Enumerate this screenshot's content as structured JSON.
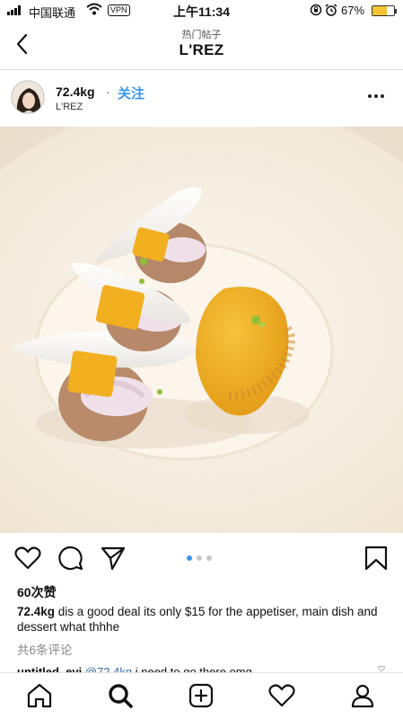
{
  "status_bar": {
    "carrier": "中国联通",
    "vpn": "VPN",
    "time": "上午11:34",
    "battery_percent": "67%",
    "battery_level": 0.67,
    "icons": [
      "signal-icon",
      "wifi-icon",
      "rotation-lock-icon",
      "alarm-icon",
      "battery-icon"
    ]
  },
  "header": {
    "subtitle": "热门帖子",
    "title": "L'REZ",
    "back_icon": "chevron-left-icon"
  },
  "post": {
    "username": "72.4kg",
    "separator": "·",
    "follow_label": "关注",
    "location": "L'REZ",
    "more_icon": "more-horizontal-icon",
    "photo_alt": "dessert-photo",
    "carousel": {
      "count": 3,
      "active": 0
    },
    "actions": [
      "heart-icon",
      "comment-icon",
      "share-icon",
      "bookmark-icon"
    ],
    "likes": "60次赞",
    "caption_user": "72.4kg",
    "caption_text": "dis a good deal its only $15 for the appetiser, main dish and dessert what thhhe",
    "comments_link": "共6条评论",
    "comment_user": "untitled_evi",
    "comment_mention": "@72.4kg",
    "comment_text": "i need to go there omg"
  },
  "tab_bar": {
    "tabs": [
      "home-icon",
      "search-icon",
      "new-post-icon",
      "activity-heart-icon",
      "profile-icon"
    ]
  },
  "colors": {
    "accent": "#3897f0",
    "mention": "#3a6ea5",
    "muted": "#888888"
  }
}
